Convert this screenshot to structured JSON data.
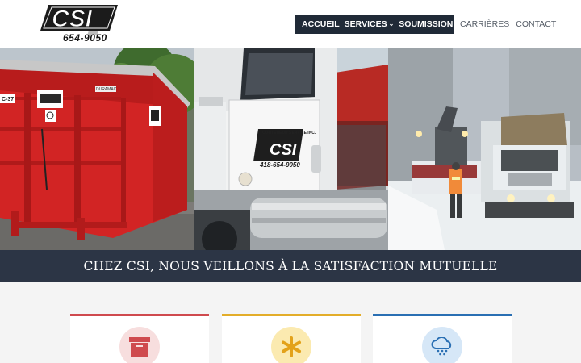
{
  "brand": {
    "logo_text": "CSI",
    "phone": "654-9050"
  },
  "nav": {
    "primary": [
      {
        "label": "ACCUEIL",
        "has_dropdown": false
      },
      {
        "label": "SERVICES",
        "has_dropdown": true
      },
      {
        "label": "SOUMISSION",
        "has_dropdown": true
      }
    ],
    "secondary": [
      {
        "label": "CARRIÈRES"
      },
      {
        "label": "CONTACT"
      }
    ],
    "dropdown_glyph": "⌄"
  },
  "hero": {
    "panels": [
      {
        "name": "container-photo",
        "labels": [
          "C-37",
          "DURAMAC"
        ]
      },
      {
        "name": "truck-photo",
        "door_text": "CONTENEUR SERVICE INC.",
        "door_logo": "CSI",
        "door_phone": "418-654-9050"
      },
      {
        "name": "snow-removal-photo"
      }
    ]
  },
  "banner": {
    "text": "CHEZ CSI, NOUS VEILLONS À LA SATISFACTION MUTUELLE"
  },
  "services": {
    "cards": [
      {
        "icon": "archive-box-icon",
        "accent": "#cf4a4e"
      },
      {
        "icon": "asterisk-icon",
        "accent": "#e3ad2a"
      },
      {
        "icon": "snow-cloud-icon",
        "accent": "#2a6fb3"
      }
    ]
  },
  "colors": {
    "nav_dark": "#202a37",
    "banner": "#2c3545",
    "section_bg": "#f4f4f4"
  }
}
